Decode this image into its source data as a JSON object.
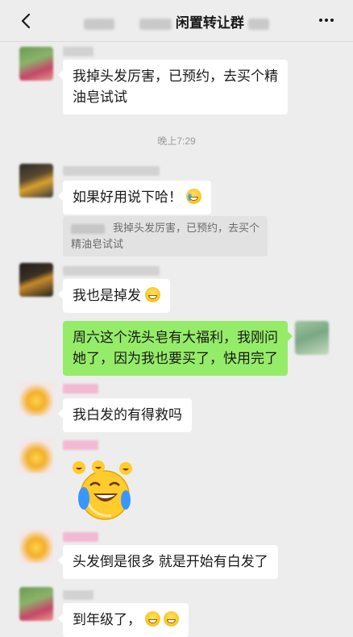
{
  "header": {
    "title": "闲置转让群",
    "back_icon": "chevron-left-icon",
    "more_icon": "more-dots-icon"
  },
  "messages": [
    {
      "type": "text",
      "side": "left",
      "text_line1": "我掉头发厉害，已预约，去买个精",
      "text_line2": "油皂试试"
    },
    {
      "type": "time",
      "text": "晚上7:29"
    },
    {
      "type": "text",
      "side": "left",
      "text": "如果好用说下哈！",
      "emoji": "crying-laughing-emoji",
      "quote_line1": "我掉头发厉害，已预约，去买个",
      "quote_line2": "精油皂试试"
    },
    {
      "type": "text",
      "side": "left",
      "text": "我也是掉发",
      "emoji": "grinning-emoji"
    },
    {
      "type": "text",
      "side": "right",
      "text_line1": "周六这个洗头皂有大福利，我刚问",
      "text_line2": "她了，因为我也要买了，快用完了"
    },
    {
      "type": "text",
      "side": "left",
      "text": "我白发的有得救吗"
    },
    {
      "type": "sticker",
      "side": "left",
      "emoji": "crying-laughing-sticker"
    },
    {
      "type": "text",
      "side": "left",
      "text": "头发倒是很多 就是开始有白发了"
    },
    {
      "type": "text",
      "side": "left",
      "text": "到年级了，",
      "emoji": "grinning-emoji"
    }
  ]
}
